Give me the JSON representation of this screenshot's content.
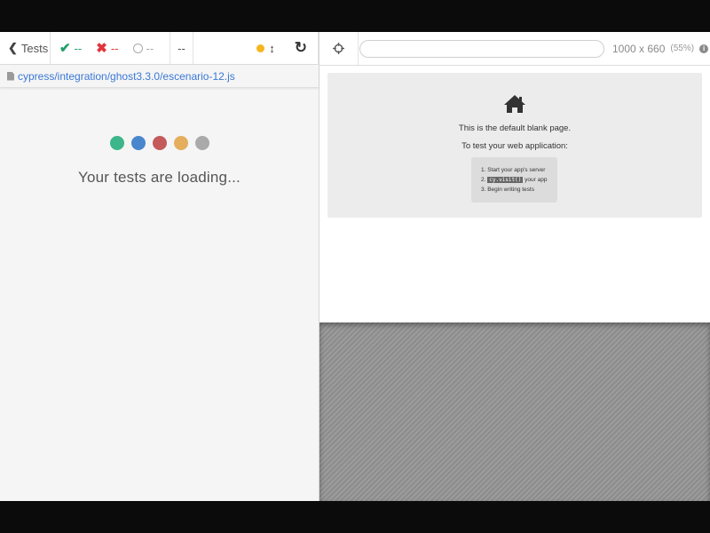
{
  "reporter": {
    "tests_label": "Tests",
    "passed": "--",
    "failed": "--",
    "pending": "--",
    "duration": "--",
    "spec_path": "cypress/integration/ghost3.3.0/escenario-12.js",
    "loading_text": "Your tests are loading...",
    "loader_dot_colors": [
      "#3cb68a",
      "#4a86cc",
      "#c45a5a",
      "#e4ae5c",
      "#aaaaaa"
    ],
    "indicator_color": "#f5b61e"
  },
  "runner": {
    "url_value": "",
    "viewport_size": "1000 x 660",
    "zoom": "(55%)",
    "blank_page": {
      "line1": "This is the default blank page.",
      "line2": "To test your web application:",
      "step1": "1. Start your app's server",
      "step2_prefix": "2.",
      "step2_code": "cy.visit()",
      "step2_suffix": "your app",
      "step3": "3. Begin writing tests"
    }
  },
  "icons": {
    "back": "chevron-left-icon",
    "pass": "check-icon",
    "fail": "x-icon",
    "pending": "circle-icon",
    "viewport": "arrows-vertical-icon",
    "reload": "reload-icon",
    "selector": "crosshair-icon",
    "info": "info-icon",
    "home": "home-icon",
    "file": "file-icon"
  }
}
